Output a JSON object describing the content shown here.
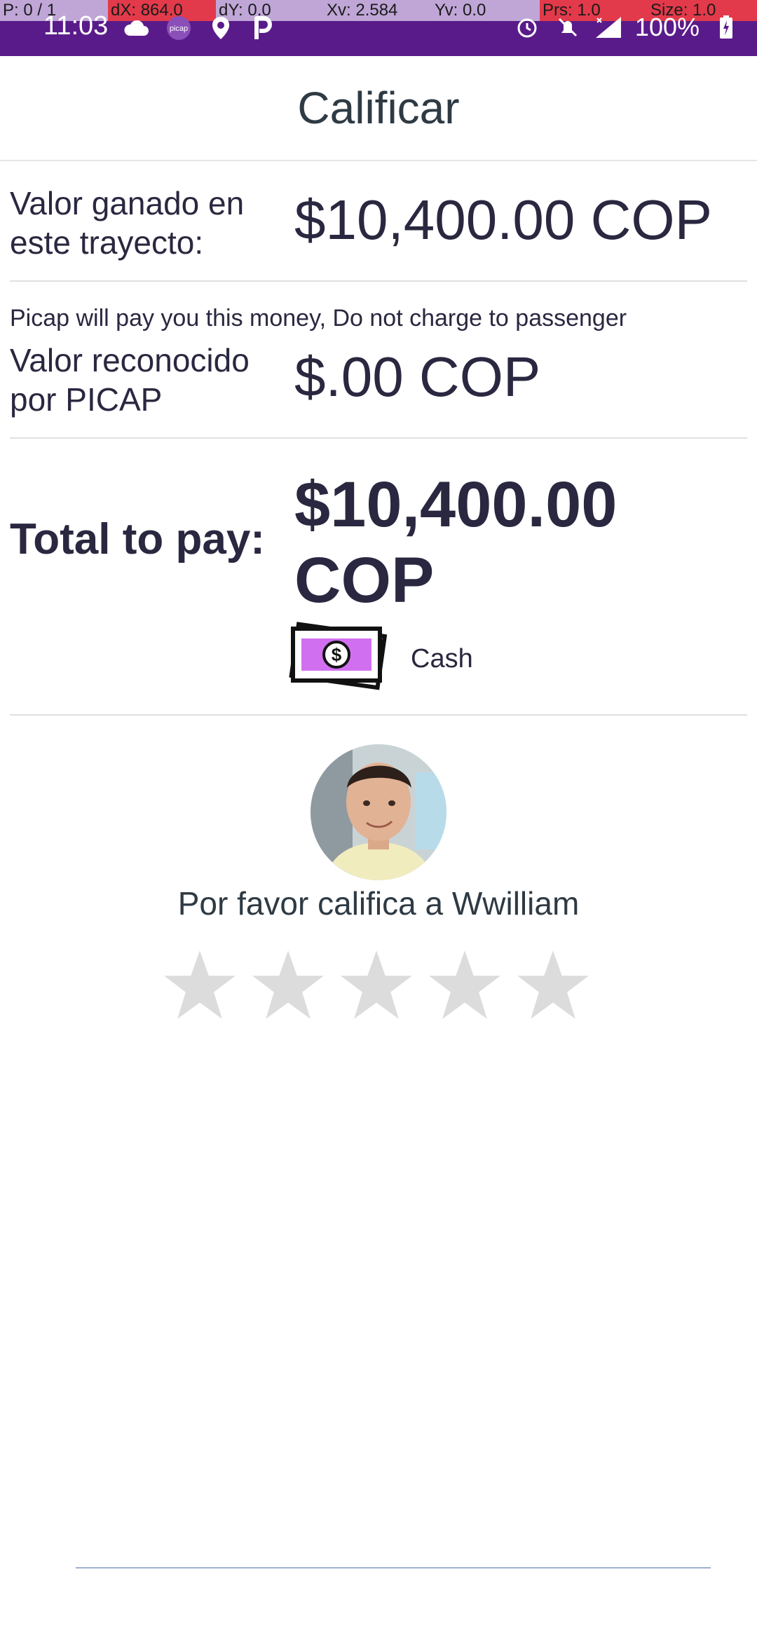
{
  "status": {
    "debug": {
      "p": "P: 0 / 1",
      "dx": "dX: 864.0",
      "dy": "dY: 0.0",
      "xv": "Xv: 2.584",
      "yv": "Yv: 0.0",
      "prs": "Prs: 1.0",
      "size": "Size: 1.0"
    },
    "time": "11:03",
    "battery": "100%"
  },
  "header": {
    "title": "Calificar"
  },
  "earned": {
    "label": "Valor ganado en este trayecto:",
    "amount": "$10,400.00 COP"
  },
  "recognized": {
    "note": "Picap will pay you this money, Do not charge to passenger",
    "label": "Valor reconocido por PICAP",
    "amount": "$.00 COP"
  },
  "total": {
    "label": "Total to pay:",
    "amount": "$10,400.00 COP",
    "payment_method": "Cash"
  },
  "rating": {
    "prompt": "Por favor califica a Wwilliam",
    "stars_selected": 0,
    "stars_total": 5
  },
  "colors": {
    "status_bar": "#5a1b8a",
    "text": "#2a2840",
    "star_empty": "#dcdcdc",
    "cash_purple": "#d070f0"
  }
}
